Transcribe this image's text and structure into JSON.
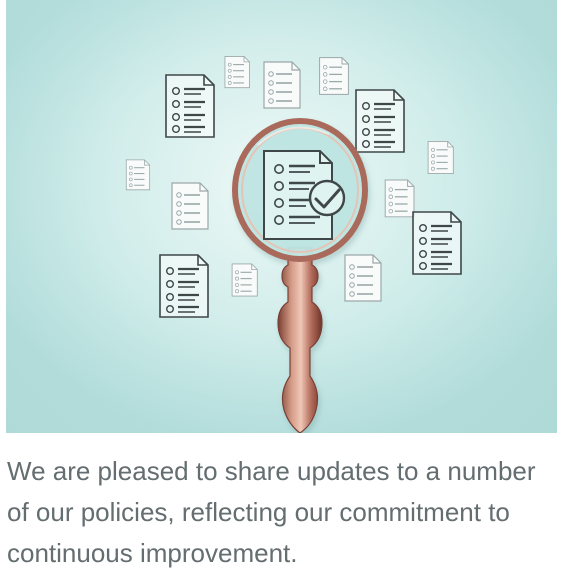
{
  "image": {
    "alt": "Magnifying glass inspecting a checklist document surrounded by floating checklist documents",
    "colors": {
      "background": "#c6e8e6",
      "copper": "#b77767",
      "ink": "#3f4748"
    },
    "icons": [
      "magnifying-glass-icon",
      "checklist-document-icon",
      "checkmark-circle-icon"
    ]
  },
  "caption": {
    "text": "We are pleased to share updates to a number of our policies, reflecting our commitment to continuous improvement."
  }
}
